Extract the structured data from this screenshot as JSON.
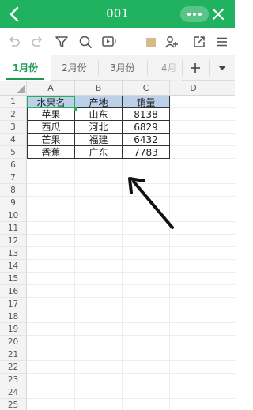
{
  "titlebar": {
    "title": "001",
    "icons": [
      "back-icon",
      "more-icon",
      "close-icon"
    ]
  },
  "toolbar": {
    "icons": [
      "undo-icon",
      "redo-icon",
      "filter-icon",
      "search-icon",
      "read-aloud-icon",
      "add-user-icon",
      "share-icon",
      "menu-icon"
    ]
  },
  "tabs": {
    "items": [
      "1月份",
      "2月份",
      "3月份",
      "4月"
    ],
    "active": 0,
    "add_icon": "plus-icon",
    "dropdown_icon": "caret-down-icon"
  },
  "sheet": {
    "columns": [
      "A",
      "B",
      "C",
      "D"
    ],
    "rows": [
      "1",
      "2",
      "3",
      "4",
      "5",
      "6",
      "7",
      "8",
      "9",
      "10",
      "11",
      "12",
      "13",
      "14",
      "15",
      "16",
      "17",
      "18",
      "19",
      "20",
      "21",
      "22",
      "23",
      "24",
      "25"
    ],
    "table": [
      [
        "水果名",
        "产地",
        "销量"
      ],
      [
        "苹果",
        "山东",
        "8138"
      ],
      [
        "西瓜",
        "河北",
        "6829"
      ],
      [
        "芒果",
        "福建",
        "6432"
      ],
      [
        "香蕉",
        "广东",
        "7783"
      ]
    ],
    "selected_cell": "A1",
    "header_fill": "#bcd0ea"
  },
  "colors": {
    "accent": "#21b25f",
    "active_tab": "#1d9b52"
  }
}
